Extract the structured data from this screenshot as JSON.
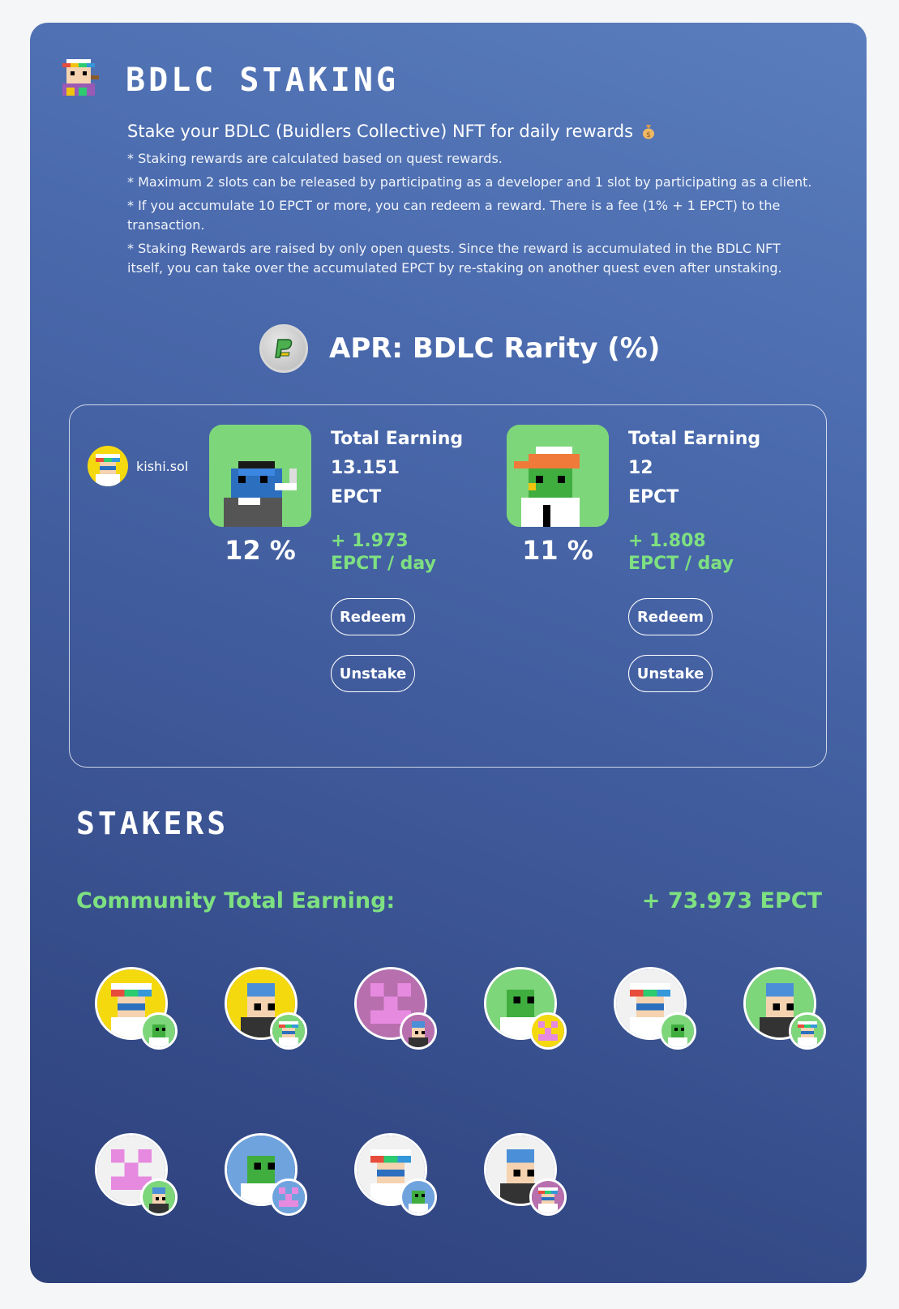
{
  "header": {
    "title": "BDLC STAKING",
    "avatar_icon": "pixel-avatar-rainbow-cap-icon"
  },
  "intro": {
    "heading": "Stake your BDLC (Buidlers Collective) NFT for daily rewards",
    "heading_icon": "money-bag-icon",
    "notes": [
      "* Staking rewards are calculated based on quest rewards.",
      "* Maximum 2 slots can be released by participating as a developer and 1 slot by participating as a client.",
      "* If you accumulate 10 EPCT or more, you can redeem a reward. There is a fee (1% + 1 EPCT) to the transaction.",
      "* Staking Rewards are raised by only open quests. Since the reward is accumulated in the BDLC NFT itself, you can take over the accumulated EPCT by re-staking on another quest even after unstaking."
    ]
  },
  "apr": {
    "title": "APR: BDLC Rarity (%)",
    "icon": "epct-coin-icon"
  },
  "owner": {
    "name": "kishi.sol",
    "avatar_icon": "owner-avatar-icon"
  },
  "staked": [
    {
      "rarity": "12 %",
      "earning_label": "Total Earning",
      "earning_value": "13.151",
      "earning_unit": "EPCT",
      "rate_value": "+ 1.973",
      "rate_unit": "EPCT / day",
      "redeem_label": "Redeem",
      "unstake_label": "Unstake",
      "image_icon": "blue-character-nft-icon"
    },
    {
      "rarity": "11 %",
      "earning_label": "Total Earning",
      "earning_value": "12",
      "earning_unit": "EPCT",
      "rate_value": "+ 1.808",
      "rate_unit": "EPCT / day",
      "redeem_label": "Redeem",
      "unstake_label": "Unstake",
      "image_icon": "green-character-orange-cap-nft-icon"
    }
  ],
  "stakers": {
    "title": "STAKERS",
    "community_label": "Community Total Earning:",
    "community_value": "+ 73.973 EPCT",
    "items": [
      {
        "main_bg": "#f5d90f",
        "mini_bg": "#7ed67b",
        "main_icon": "rainbow-cap-avatar-icon",
        "mini_icon": "blue-character-icon"
      },
      {
        "main_bg": "#f5d90f",
        "mini_bg": "#7ed67b",
        "main_icon": "rainbow-cap-avatar-icon",
        "mini_icon": "green-orange-cap-icon"
      },
      {
        "main_bg": "#b86fae",
        "mini_bg": "#b86fae",
        "main_icon": "blue-cap-avatar-icon",
        "mini_icon": "green-blue-cap-icon"
      },
      {
        "main_bg": "#7ed67b",
        "mini_bg": "#f5d90f",
        "main_icon": "headphone-avatar-icon",
        "mini_icon": "blonde-avatar-icon"
      },
      {
        "main_bg": "#f1f1f1",
        "mini_bg": "#7ed67b",
        "main_icon": "pink-pixel-pattern-icon",
        "mini_icon": "top-hat-avatar-icon"
      },
      {
        "main_bg": "#7ed67b",
        "mini_bg": "#7ed67b",
        "main_icon": "rainbow-cap-avatar-icon",
        "mini_icon": "green-headphone-icon"
      },
      {
        "main_bg": "#f1f1f1",
        "mini_bg": "#7ed67b",
        "main_icon": "green-pixel-pattern-icon",
        "mini_icon": "red-cap-avatar-icon"
      },
      {
        "main_bg": "#6fa3de",
        "mini_bg": "#6fa3de",
        "main_icon": "orange-cap-avatar-icon",
        "mini_icon": "orange-cap-mini-icon"
      },
      {
        "main_bg": "#f1f1f1",
        "mini_bg": "#6fa3de",
        "main_icon": "purple-cross-pattern-icon",
        "mini_icon": "sunglasses-avatar-icon"
      },
      {
        "main_bg": "#f1f1f1",
        "mini_bg": "#b86fae",
        "main_icon": "blue-block-pattern-icon",
        "mini_icon": "pink-face-avatar-icon"
      }
    ]
  },
  "colors": {
    "accent_green": "#7ee081",
    "panel_blue": "#4a6aad",
    "nft_green": "#7ed67b"
  }
}
